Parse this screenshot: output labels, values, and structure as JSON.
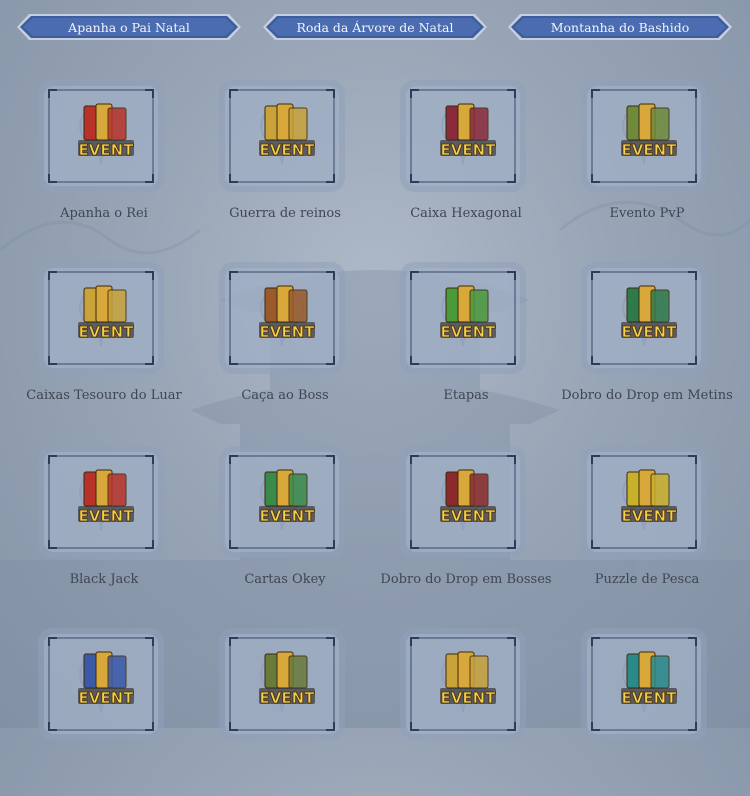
{
  "tabs": [
    {
      "label": "Apanha o Pai Natal"
    },
    {
      "label": "Roda da Árvore de Natal"
    },
    {
      "label": "Montanha do Bashido"
    }
  ],
  "event_badge": "EVENT",
  "events": [
    {
      "label": "Apanha o Rei",
      "icon": "cards-crown-icon",
      "color": "#b8322a"
    },
    {
      "label": "Guerra de reinos",
      "icon": "kingdom-banners-icon",
      "color": "#c9a23a"
    },
    {
      "label": "Caixa Hexagonal",
      "icon": "hexagon-box-icon",
      "color": "#8a2a3a"
    },
    {
      "label": "Evento PvP",
      "icon": "crossed-swords-icon",
      "color": "#6f8a3a"
    },
    {
      "label": "Caixas Tesouro do Luar",
      "icon": "gold-chest-icon",
      "color": "#c9a23a"
    },
    {
      "label": "Caça ao Boss",
      "icon": "boss-hunt-icon",
      "color": "#9a5a2a"
    },
    {
      "label": "Etapas",
      "icon": "green-claw-icon",
      "color": "#4a9a3a"
    },
    {
      "label": "Dobro do Drop em Metins",
      "icon": "metin-stone-icon",
      "color": "#2f7a4a"
    },
    {
      "label": "Black Jack",
      "icon": "playing-cards-icon",
      "color": "#b8322a"
    },
    {
      "label": "Cartas Okey",
      "icon": "okey-cards-icon",
      "color": "#3a8a4a"
    },
    {
      "label": "Dobro do Drop em Bosses",
      "icon": "boss-drop-icon",
      "color": "#8a2a2a"
    },
    {
      "label": "Puzzle de Pesca",
      "icon": "fishing-puzzle-icon",
      "color": "#c9b02a"
    },
    {
      "label": "",
      "icon": "books-icon",
      "color": "#3a5aa8"
    },
    {
      "label": "",
      "icon": "bow-weapon-icon",
      "color": "#6a7a3a"
    },
    {
      "label": "",
      "icon": "gems-icon",
      "color": "#c9a23a"
    },
    {
      "label": "",
      "icon": "dragon-icon",
      "color": "#2a8a8a"
    }
  ]
}
